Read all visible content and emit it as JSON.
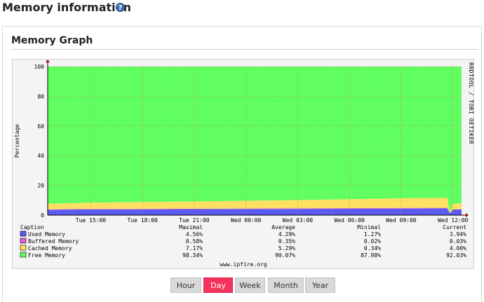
{
  "page": {
    "title": "Memory information",
    "help_icon": "question-mark-icon"
  },
  "panel": {
    "title": "Memory Graph"
  },
  "graph": {
    "watermark": "RRDTOOL / TOBI OETIKER",
    "footer": "www.ipfire.org",
    "colors": {
      "used": "#5b5bf0",
      "buffered": "#e060e0",
      "cached": "#ffe060",
      "free": "#60ff60"
    },
    "legend": {
      "headers": [
        "Caption",
        "Maximal",
        "Average",
        "Minimal",
        "Current"
      ],
      "rows": [
        {
          "name": "Used Memory",
          "color": "#5b5bf0",
          "max": "4.56%",
          "avg": "4.29%",
          "min": "1.27%",
          "cur": "3.94%"
        },
        {
          "name": "Buffered Memory",
          "color": "#e060e0",
          "max": "0.58%",
          "avg": "0.35%",
          "min": "0.02%",
          "cur": "0.03%"
        },
        {
          "name": "Cached Memory",
          "color": "#ffe060",
          "max": "7.17%",
          "avg": "5.29%",
          "min": "0.34%",
          "cur": "4.00%"
        },
        {
          "name": "Free Memory",
          "color": "#60ff60",
          "max": "98.34%",
          "avg": "90.07%",
          "min": "87.98%",
          "cur": "92.03%"
        }
      ]
    }
  },
  "chart_data": {
    "type": "area",
    "ylabel": "Percentage",
    "ylim": [
      0,
      100
    ],
    "yticks": [
      0,
      20,
      40,
      60,
      80,
      100
    ],
    "xticks": [
      "Tue 15:00",
      "Tue 18:00",
      "Tue 21:00",
      "Wed 00:00",
      "Wed 03:00",
      "Wed 06:00",
      "Wed 09:00",
      "Wed 12:00"
    ],
    "x": [
      "Tue 12:30",
      "Tue 15:00",
      "Tue 18:00",
      "Tue 21:00",
      "Wed 00:00",
      "Wed 03:00",
      "Wed 06:00",
      "Wed 09:00",
      "Wed 11:40",
      "Wed 11:50",
      "Wed 12:00",
      "Wed 12:30"
    ],
    "series": [
      {
        "name": "Used Memory",
        "values": [
          3.6,
          3.8,
          3.9,
          4.0,
          4.1,
          4.2,
          4.3,
          4.4,
          4.5,
          1.3,
          3.9,
          3.9
        ]
      },
      {
        "name": "Buffered Memory",
        "values": [
          0.3,
          0.3,
          0.3,
          0.3,
          0.35,
          0.35,
          0.4,
          0.4,
          0.4,
          0.05,
          0.03,
          0.03
        ]
      },
      {
        "name": "Cached Memory",
        "values": [
          3.8,
          4.3,
          4.6,
          4.9,
          5.2,
          5.6,
          6.0,
          6.5,
          6.8,
          0.5,
          3.8,
          4.0
        ]
      },
      {
        "name": "Free Memory",
        "values": [
          92.3,
          91.6,
          91.2,
          90.8,
          90.35,
          89.85,
          89.3,
          88.7,
          88.3,
          98.15,
          92.27,
          92.07
        ]
      }
    ]
  },
  "tabs": [
    {
      "label": "Hour",
      "active": false
    },
    {
      "label": "Day",
      "active": true
    },
    {
      "label": "Week",
      "active": false
    },
    {
      "label": "Month",
      "active": false
    },
    {
      "label": "Year",
      "active": false
    }
  ]
}
